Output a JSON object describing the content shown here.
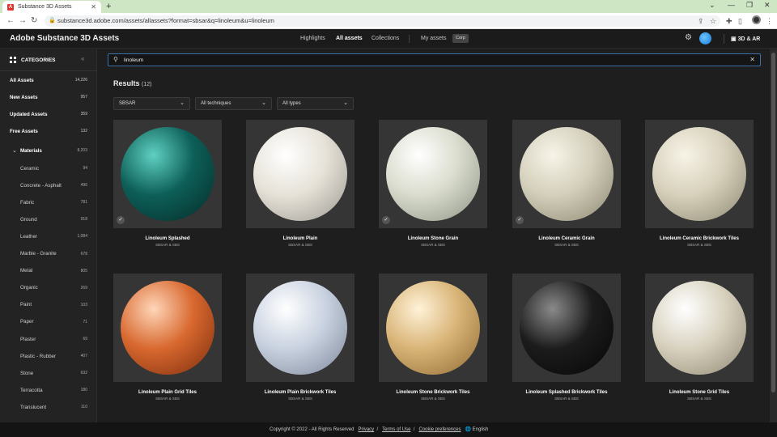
{
  "browser": {
    "tab_title": "Substance 3D Assets",
    "url": "substance3d.adobe.com/assets/allassets?format=sbsar&q=linoleum&u=linoleum",
    "new_tab": "+"
  },
  "header": {
    "brand": "Adobe Substance 3D Assets",
    "nav": [
      "Highlights",
      "All assets",
      "Collections"
    ],
    "my_assets": "My assets",
    "badge": "Corp",
    "ar_link": "3D & AR"
  },
  "sidebar": {
    "title": "CATEGORIES",
    "top_items": [
      {
        "label": "All Assets",
        "count": "14,226"
      },
      {
        "label": "New Assets",
        "count": "957"
      },
      {
        "label": "Updated Assets",
        "count": "359"
      },
      {
        "label": "Free Assets",
        "count": "132"
      }
    ],
    "materials": {
      "label": "Materials",
      "count": "8,203"
    },
    "sub_items": [
      {
        "label": "Ceramic",
        "count": "94"
      },
      {
        "label": "Concrete - Asphalt",
        "count": "496"
      },
      {
        "label": "Fabric",
        "count": "781"
      },
      {
        "label": "Ground",
        "count": "918"
      },
      {
        "label": "Leather",
        "count": "1,084"
      },
      {
        "label": "Marble - Granite",
        "count": "678"
      },
      {
        "label": "Metal",
        "count": "805"
      },
      {
        "label": "Organic",
        "count": "269"
      },
      {
        "label": "Paint",
        "count": "103"
      },
      {
        "label": "Paper",
        "count": "71"
      },
      {
        "label": "Plaster",
        "count": "69"
      },
      {
        "label": "Plastic - Rubber",
        "count": "407"
      },
      {
        "label": "Stone",
        "count": "632"
      },
      {
        "label": "Terracotta",
        "count": "180"
      },
      {
        "label": "Translucent",
        "count": "110"
      }
    ]
  },
  "search": {
    "value": "linoleum"
  },
  "results": {
    "label": "Results",
    "count": "(12)"
  },
  "filters": [
    "SBSAR",
    "All techniques",
    "All types"
  ],
  "assets": [
    {
      "title": "Linoleum Splashed",
      "sub": "SBSAR & SBS",
      "checked": true,
      "c1": "#5fd0c2",
      "c2": "#0d5f58",
      "c3": "#052a27"
    },
    {
      "title": "Linoleum Plain",
      "sub": "SBSAR & SBS",
      "checked": false,
      "c1": "#ffffff",
      "c2": "#e6e2d8",
      "c3": "#9b9890"
    },
    {
      "title": "Linoleum Stone Grain",
      "sub": "SBSAR & SBS",
      "checked": true,
      "c1": "#ffffff",
      "c2": "#d9dccd",
      "c3": "#8c9284"
    },
    {
      "title": "Linoleum Ceramic Grain",
      "sub": "SBSAR & SBS",
      "checked": true,
      "c1": "#f7f4e8",
      "c2": "#d4cfbb",
      "c3": "#8a866f"
    },
    {
      "title": "Linoleum Ceramic Brickwork Tiles",
      "sub": "SBSAR & SBS",
      "checked": false,
      "c1": "#f7f3e6",
      "c2": "#d7d1bc",
      "c3": "#8d8873"
    },
    {
      "title": "Linoleum Plain Grid Tiles",
      "sub": "SBSAR & SBS",
      "checked": false,
      "c1": "#ffd6b8",
      "c2": "#d8682f",
      "c3": "#7a2c0c"
    },
    {
      "title": "Linoleum Plain Brickwork Tiles",
      "sub": "SBSAR & SBS",
      "checked": false,
      "c1": "#ffffff",
      "c2": "#c9d2e0",
      "c3": "#7d8799"
    },
    {
      "title": "Linoleum Stone Brickwork Tiles",
      "sub": "SBSAR & SBS",
      "checked": false,
      "c1": "#fff2d8",
      "c2": "#d9b477",
      "c3": "#8f6a33"
    },
    {
      "title": "Linoleum Splashed Brickwork Tiles",
      "sub": "SBSAR & SBS",
      "checked": false,
      "c1": "#8a8a8a",
      "c2": "#1c1c1c",
      "c3": "#050505"
    },
    {
      "title": "Linoleum Stone Grid Tiles",
      "sub": "SBSAR & SBS",
      "checked": false,
      "c1": "#ffffff",
      "c2": "#d8d2bf",
      "c3": "#8f8773"
    }
  ],
  "footer": {
    "copyright": "Copyright © 2022 - All Rights Reserved",
    "privacy": "Privacy",
    "terms": "Terms of Use",
    "cookies": "Cookie preferences",
    "language": "English"
  }
}
